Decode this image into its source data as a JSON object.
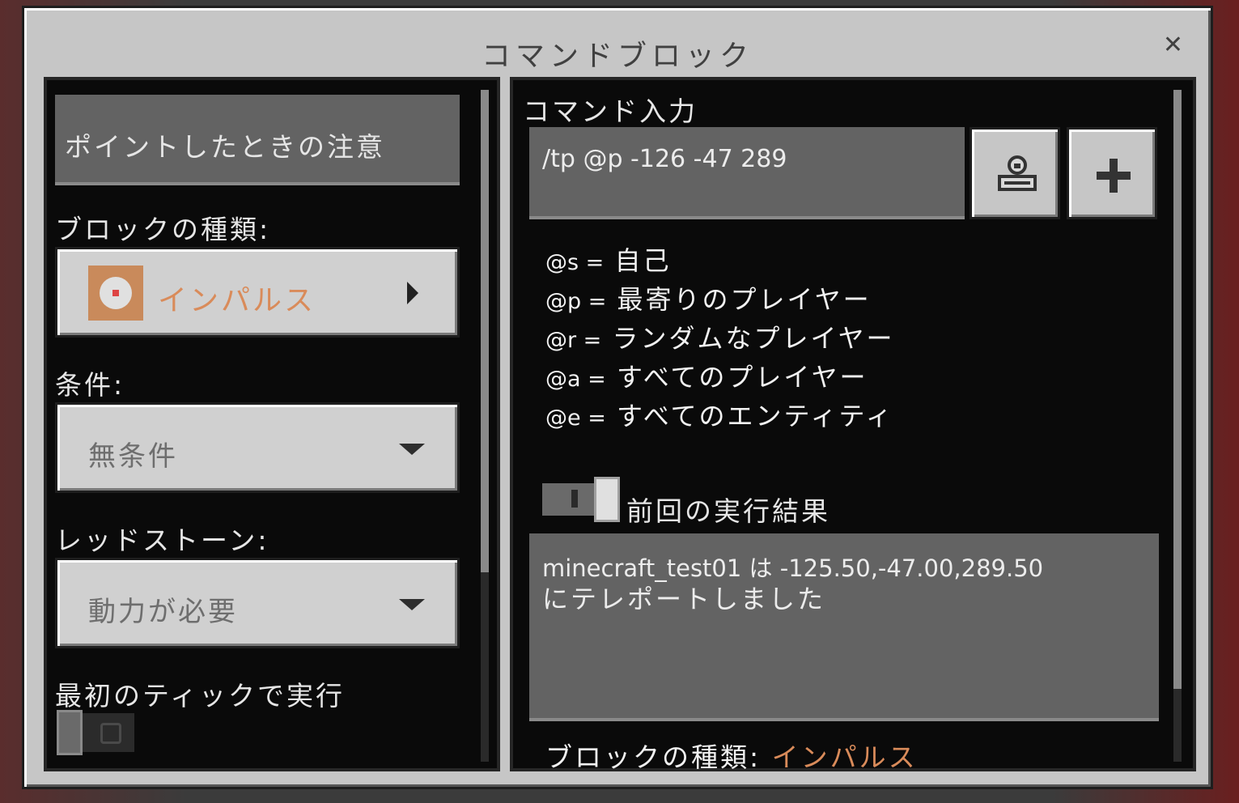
{
  "dialog": {
    "title": "コマンドブロック",
    "close_glyph": "✕"
  },
  "left": {
    "hover_note": "ポイントしたときの注意",
    "block_type_label": "ブロックの種類:",
    "block_type_value": "インパルス",
    "condition_label": "条件:",
    "condition_value": "無条件",
    "redstone_label": "レッドストーン:",
    "redstone_value": "動力が必要",
    "first_tick_label": "最初のティックで実行",
    "first_tick_enabled": false
  },
  "right": {
    "command_label": "コマンド入力",
    "command_value": "/tp @p -126 -47 289",
    "selectors": [
      {
        "key": "@s =",
        "desc": "自己"
      },
      {
        "key": "@p =",
        "desc": "最寄りのプレイヤー"
      },
      {
        "key": "@r =",
        "desc": "ランダムなプレイヤー"
      },
      {
        "key": "@a =",
        "desc": "すべてのプレイヤー"
      },
      {
        "key": "@e =",
        "desc": "すべてのエンティティ"
      }
    ],
    "previous_output_label": "前回の実行結果",
    "previous_output_enabled": true,
    "output_line1": "minecraft_test01 は -125.50,-47.00,289.50",
    "output_line2": "にテレポートしました",
    "footer_label": "ブロックの種類:",
    "footer_value": "インパルス"
  },
  "colors": {
    "accent_orange": "#d98b5a",
    "dialog_bg": "#c6c6c6",
    "panel_bg": "#0a0a0a"
  },
  "icons": [
    "close-icon",
    "command-block-icon",
    "chevron-right-icon",
    "dropdown-caret-icon",
    "selector-icon",
    "plus-icon"
  ]
}
